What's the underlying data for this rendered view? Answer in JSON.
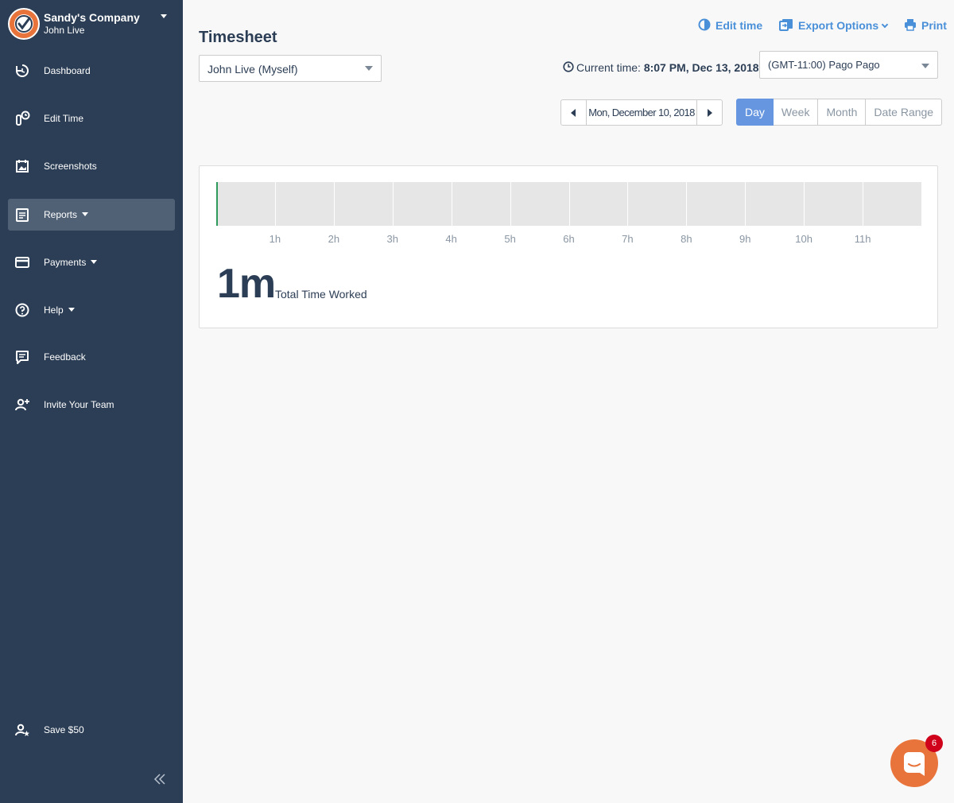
{
  "brand": {
    "company": "Sandy's Company",
    "user": "John Live"
  },
  "sidebar": {
    "items": [
      {
        "label": "Dashboard",
        "icon": "dashboard-icon"
      },
      {
        "label": "Edit Time",
        "icon": "edit-time-icon"
      },
      {
        "label": "Screenshots",
        "icon": "screenshots-icon"
      },
      {
        "label": "Reports",
        "icon": "reports-icon",
        "active": true,
        "dropdown": true
      },
      {
        "label": "Payments",
        "icon": "credit-card-icon",
        "dropdown": true
      },
      {
        "label": "Help",
        "icon": "help-icon",
        "dropdown": true
      },
      {
        "label": "Feedback",
        "icon": "feedback-icon"
      },
      {
        "label": "Invite Your Team",
        "icon": "add-user-icon"
      }
    ],
    "save": {
      "label": "Save $50",
      "icon": "user-star-icon"
    }
  },
  "page": {
    "title": "Timesheet"
  },
  "toolbar": {
    "edit_time": "Edit time",
    "export": "Export Options",
    "print": "Print"
  },
  "user_select": {
    "value": "John Live (Myself)"
  },
  "current_time": {
    "label": "Current time:",
    "value": "8:07 PM, Dec 13, 2018"
  },
  "timezone_select": {
    "value": "(GMT-11:00) Pago Pago"
  },
  "date_nav": {
    "date": "Mon, December 10, 2018"
  },
  "range": {
    "options": [
      "Day",
      "Week",
      "Month",
      "Date Range"
    ],
    "active": "Day"
  },
  "timeline": {
    "ticks": [
      "1h",
      "2h",
      "3h",
      "4h",
      "5h",
      "6h",
      "7h",
      "8h",
      "9h",
      "10h",
      "11h"
    ],
    "total": "1m",
    "total_label": "Total Time Worked"
  },
  "chat": {
    "badge": "6"
  },
  "colors": {
    "sidebar": "#2c3e55",
    "accent": "#4a90d9",
    "active_segment": "#6596df",
    "worked": "#2e9b5d",
    "chat": "#e8743b"
  }
}
